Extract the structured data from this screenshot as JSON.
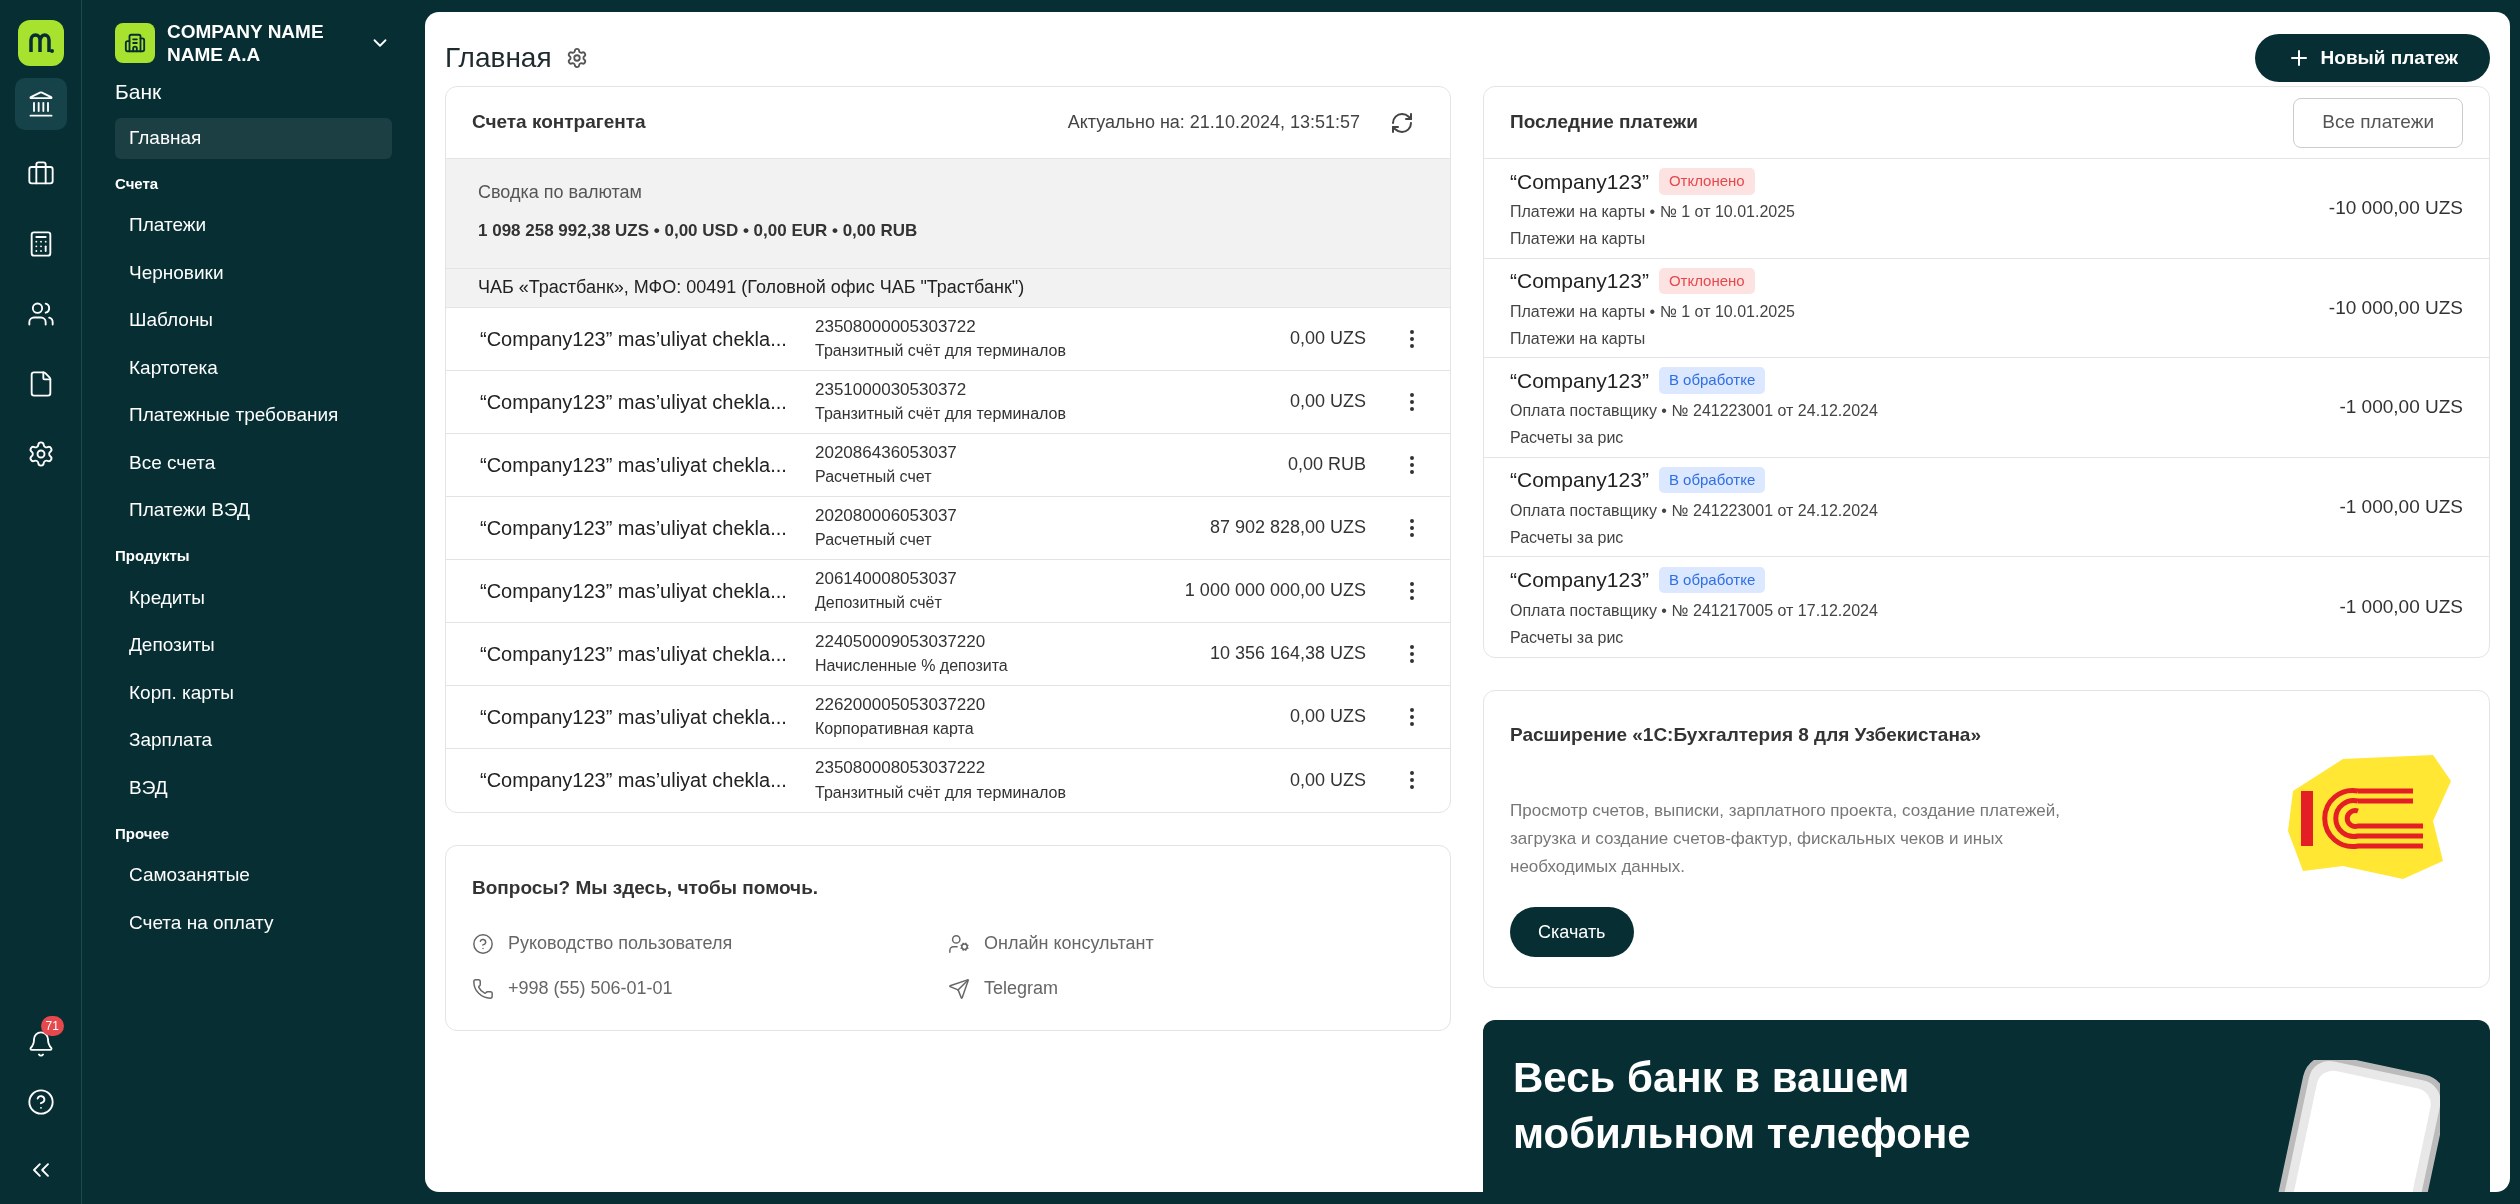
{
  "rail": {
    "items": [
      {
        "kind": "bank",
        "selected": true
      },
      {
        "kind": "briefcase",
        "selected": false
      },
      {
        "kind": "calculator",
        "selected": false
      },
      {
        "kind": "users",
        "selected": false
      },
      {
        "kind": "document",
        "selected": false
      },
      {
        "kind": "settings",
        "selected": false
      }
    ],
    "notifications": "71"
  },
  "sidebar": {
    "company": "COMPANY NAME NAME A.A",
    "title": "Банк",
    "sections": [
      {
        "items": [
          {
            "label": "Главная",
            "selected": true
          }
        ]
      },
      {
        "label": "Счета",
        "items": [
          {
            "label": "Платежи",
            "selected": false
          },
          {
            "label": "Черновики",
            "selected": false
          },
          {
            "label": "Шаблоны",
            "selected": false
          },
          {
            "label": "Картотека",
            "selected": false
          },
          {
            "label": "Платежные требования",
            "selected": false
          },
          {
            "label": "Все счета",
            "selected": false
          },
          {
            "label": "Платежи ВЭД",
            "selected": false
          }
        ]
      },
      {
        "label": "Продукты",
        "items": [
          {
            "label": "Кредиты",
            "selected": false
          },
          {
            "label": "Депозиты",
            "selected": false
          },
          {
            "label": "Корп. карты",
            "selected": false
          },
          {
            "label": "Зарплата",
            "selected": false
          },
          {
            "label": "ВЭД",
            "selected": false
          }
        ]
      },
      {
        "label": "Прочее",
        "items": [
          {
            "label": "Самозанятые",
            "selected": false
          },
          {
            "label": "Счета на оплату",
            "selected": false
          }
        ]
      }
    ]
  },
  "page": {
    "title": "Главная",
    "new_payment_button": "Новый платеж"
  },
  "accounts": {
    "title": "Счета контрагента",
    "updated": "Актуально на: 21.10.2024, 13:51:57",
    "summary": {
      "label": "Сводка по валютам",
      "totals": "1 098 258 992,38 UZS • 0,00 USD • 0,00 EUR • 0,00 RUB"
    },
    "bank": "ЧАБ «Трастбанк», МФО: 00491 (Головной офис ЧАБ \"Трастбанк\")",
    "rows": [
      {
        "name": "“Company123” mas’uliyat chekla...",
        "number": "23508000005303722",
        "type": "Транзитный счёт для терминалов",
        "balance": "0,00 UZS"
      },
      {
        "name": "“Company123” mas’uliyat chekla...",
        "number": "2351000030530372",
        "type": "Транзитный счёт для терминалов",
        "balance": "0,00 UZS"
      },
      {
        "name": "“Company123” mas’uliyat chekla...",
        "number": "202086436053037",
        "type": "Расчетный счет",
        "balance": "0,00 RUB"
      },
      {
        "name": "“Company123” mas’uliyat chekla...",
        "number": "202080006053037",
        "type": "Расчетный счет",
        "balance": "87 902 828,00 UZS"
      },
      {
        "name": "“Company123” mas’uliyat chekla...",
        "number": "206140008053037",
        "type": "Депозитный счёт",
        "balance": "1 000 000 000,00 UZS"
      },
      {
        "name": "“Company123” mas’uliyat chekla...",
        "number": "224050009053037220",
        "type": "Начисленные % депозита",
        "balance": "10 356 164,38 UZS"
      },
      {
        "name": "“Company123” mas’uliyat chekla...",
        "number": "226200005053037220",
        "type": "Корпоративная карта",
        "balance": "0,00 UZS"
      },
      {
        "name": "“Company123” mas’uliyat chekla...",
        "number": "235080008053037222",
        "type": "Транзитный счёт для терминалов",
        "balance": "0,00 UZS"
      }
    ]
  },
  "help": {
    "title": "Вопросы? Мы здесь, чтобы помочь.",
    "links": [
      {
        "kind": "manual",
        "label": "Руководство пользователя"
      },
      {
        "kind": "consultant",
        "label": "Онлайн консультант"
      },
      {
        "kind": "phone",
        "label": "+998 (55) 506-01-01"
      },
      {
        "kind": "telegram",
        "label": "Telegram"
      }
    ]
  },
  "payments": {
    "title": "Последние платежи",
    "all_button": "Все платежи",
    "rows": [
      {
        "name": "“Company123”",
        "status": {
          "kind": "rejected",
          "label": "Отклонено"
        },
        "details": "Платежи на карты • № 1 от 10.01.2025",
        "purpose": "Платежи на карты",
        "amount": "-10 000,00 UZS"
      },
      {
        "name": "“Company123”",
        "status": {
          "kind": "rejected",
          "label": "Отклонено"
        },
        "details": "Платежи на карты • № 1 от 10.01.2025",
        "purpose": "Платежи на карты",
        "amount": "-10 000,00 UZS"
      },
      {
        "name": "“Company123”",
        "status": {
          "kind": "processing",
          "label": "В обработке"
        },
        "details": "Оплата поставщику • № 241223001 от 24.12.2024",
        "purpose": "Расчеты за рис",
        "amount": "-1 000,00 UZS"
      },
      {
        "name": "“Company123”",
        "status": {
          "kind": "processing",
          "label": "В обработке"
        },
        "details": "Оплата поставщику • № 241223001 от 24.12.2024",
        "purpose": "Расчеты за рис",
        "amount": "-1 000,00 UZS"
      },
      {
        "name": "“Company123”",
        "status": {
          "kind": "processing",
          "label": "В обработке"
        },
        "details": "Оплата поставщику • № 241217005 от 17.12.2024",
        "purpose": "Расчеты за рис",
        "amount": "-1 000,00 UZS"
      }
    ]
  },
  "extension": {
    "title": "Расширение «1С:Бухгалтерия 8 для Узбекистана»",
    "description": "Просмотр счетов, выписки, зарплатного проекта, создание платежей, загрузка и создание счетов-фактур, фискальных чеков и иных необходимых данных.",
    "button": "Скачать"
  },
  "promo": {
    "title": "Весь банк в вашем мобильном телефоне"
  }
}
